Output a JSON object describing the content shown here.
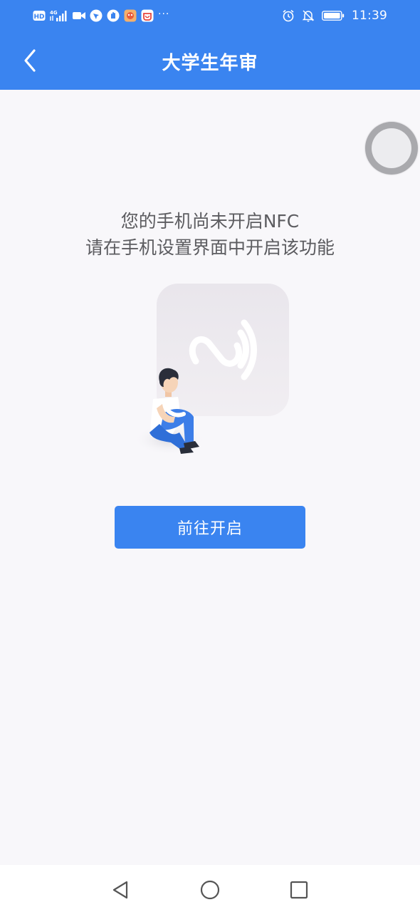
{
  "status_bar": {
    "left_icons": [
      "hd-icon",
      "4g-signal-icon",
      "video-icon",
      "app-notification-icon",
      "shield-app-icon",
      "game-app-icon",
      "shopping-app-icon"
    ],
    "overflow": "···",
    "right_icons": [
      "alarm-icon",
      "mute-icon",
      "battery-icon"
    ],
    "time": "11:39"
  },
  "header": {
    "title": "大学生年审"
  },
  "message": {
    "line1": "您的手机尚未开启NFC",
    "line2": "请在手机设置界面中开启该功能"
  },
  "action": {
    "button_label": "前往开启"
  },
  "colors": {
    "brand": "#3a84f0",
    "background": "#f8f7fa",
    "text": "#5c5c60"
  }
}
